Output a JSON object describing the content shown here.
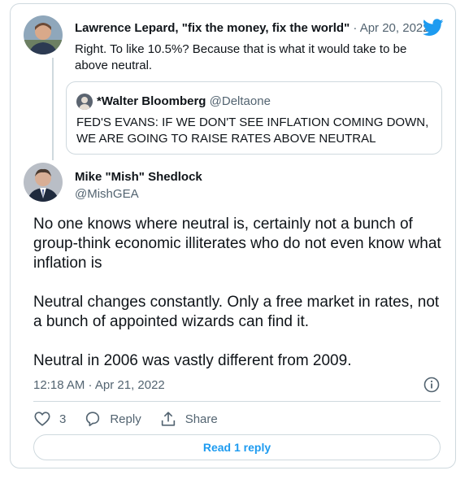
{
  "top_tweet": {
    "author_name": "Lawrence Lepard, \"fix the money, fix the world\"",
    "separator": "·",
    "date": "Apr 20, 2022",
    "text": "Right.  To like 10.5%?  Because that is what it would take to be above neutral."
  },
  "quote_tweet": {
    "author_name": "*Walter Bloomberg",
    "handle": "@Deltaone",
    "text": "FED'S EVANS: IF WE DON'T SEE INFLATION COMING DOWN, WE ARE GOING TO RAISE RATES ABOVE NEUTRAL"
  },
  "main_tweet": {
    "author_name": "Mike \"Mish\" Shedlock",
    "handle": "@MishGEA",
    "paragraphs": [
      "No one knows where neutral is, certainly not a bunch of group-think economic illiterates who do not even know what inflation is",
      "Neutral changes constantly. Only a free market in rates, not a bunch of appointed wizards can find it.",
      "Neutral in 2006 was vastly different from 2009."
    ],
    "timestamp": "12:18 AM · Apr 21, 2022"
  },
  "actions": {
    "like_count": "3",
    "reply_label": "Reply",
    "share_label": "Share"
  },
  "read_reply_label": "Read 1 reply",
  "colors": {
    "accent": "#1d9bf0",
    "secondary_text": "#536471",
    "border": "#cfd9de"
  },
  "icons": [
    "twitter-bird-icon",
    "info-icon",
    "heart-icon",
    "reply-icon",
    "share-icon"
  ]
}
